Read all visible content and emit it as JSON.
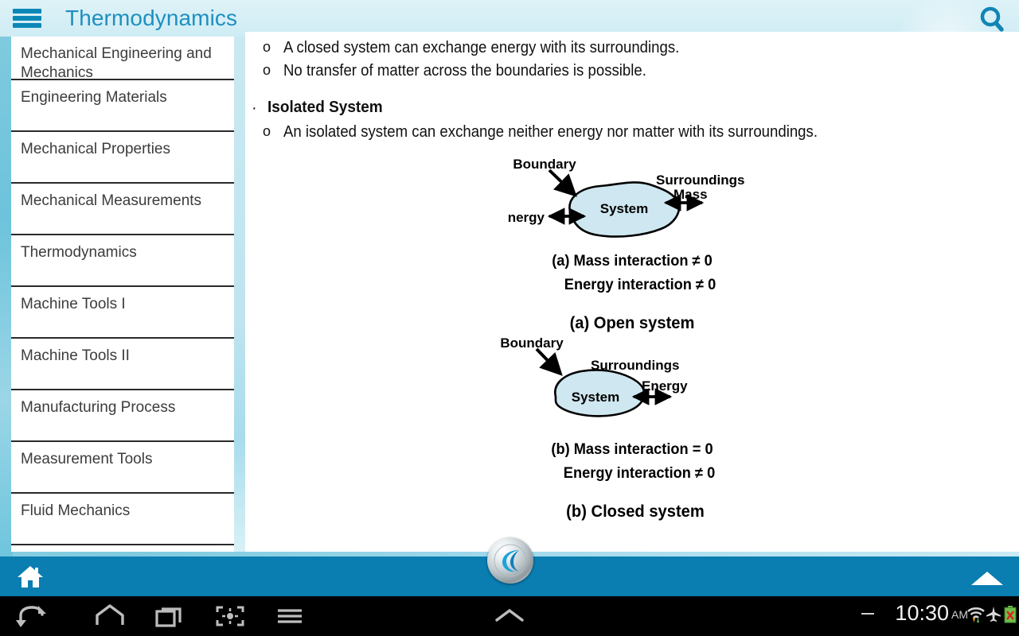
{
  "header": {
    "title": "Thermodynamics",
    "menu_icon": "hamburger-icon",
    "search_icon": "search-icon"
  },
  "sidebar": {
    "items": [
      {
        "label": "Mechanical Engineering and Mechanics"
      },
      {
        "label": "Engineering Materials"
      },
      {
        "label": "Mechanical Properties"
      },
      {
        "label": "Mechanical Measurements"
      },
      {
        "label": "Thermodynamics"
      },
      {
        "label": "Machine Tools I"
      },
      {
        "label": "Machine Tools II"
      },
      {
        "label": "Manufacturing Process"
      },
      {
        "label": "Measurement Tools"
      },
      {
        "label": "Fluid Mechanics"
      }
    ]
  },
  "content": {
    "bullet_marker": "o",
    "section_marker": "·",
    "closed_bullets": [
      "A closed system can exchange energy with its surroundings.",
      "No transfer of matter across the boundaries is possible."
    ],
    "isolated_heading": "Isolated System",
    "isolated_bullets": [
      "An isolated system can exchange neither energy nor matter with its surroundings."
    ],
    "figure_a": {
      "boundary_label": "Boundary",
      "surroundings_label": "Surroundings",
      "system_label": "System",
      "energy_label": "Energy",
      "mass_label": "Mass",
      "caption_line1": "(a) Mass interaction ≠ 0",
      "caption_line2": "Energy interaction ≠ 0",
      "caption_title": "(a) Open system",
      "blob_fill": "#cfe7f0"
    },
    "figure_b": {
      "boundary_label": "Boundary",
      "surroundings_label": "Surroundings",
      "system_label": "System",
      "energy_label": "Energy",
      "caption_line1": "(b) Mass interaction = 0",
      "caption_line2": "Energy interaction ≠ 0",
      "caption_title": "(b) Closed system",
      "blob_fill": "#cfe7f0"
    }
  },
  "bottom_bar": {
    "home_icon": "home-icon",
    "logo_icon": "app-logo-icon",
    "expand_icon": "chevron-up-icon",
    "accent_color": "#0a7db1"
  },
  "navbar": {
    "back_icon": "back-arrow-icon",
    "home_icon": "home-outline-icon",
    "recents_icon": "recent-apps-icon",
    "screenshot_icon": "screenshot-icon",
    "menu_icon": "menu-icon",
    "up_icon": "chevron-up-icon",
    "clock": "10:30",
    "clock_period": "AM",
    "wifi_icon": "wifi-icon",
    "airplane_icon": "airplane-mode-icon",
    "battery_icon": "battery-error-icon"
  }
}
